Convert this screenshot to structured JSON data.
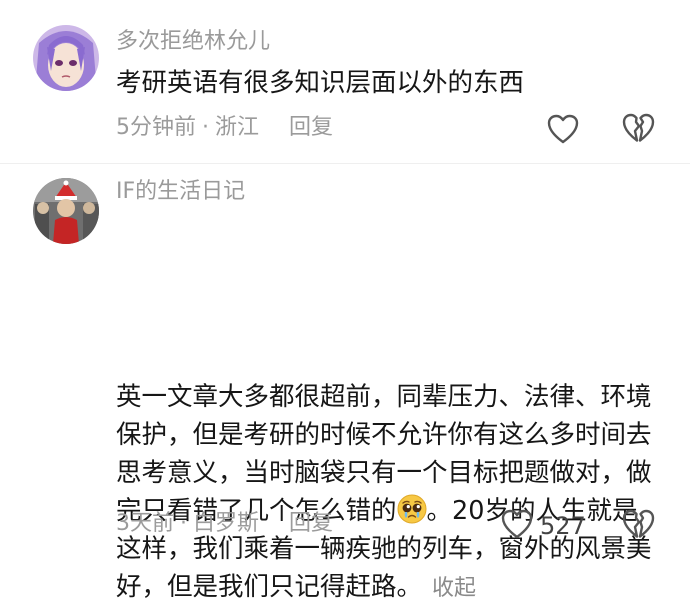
{
  "comments": [
    {
      "username": "多次拒绝林允儿",
      "text": "考研英语有很多知识层面以外的东西",
      "time": "5分钟前",
      "separator": "·",
      "location": "浙江",
      "reply_label": "回复"
    },
    {
      "username": "IF的生活日记",
      "text_part1": "英一文章大多都很超前，同辈压力、法律、环境保护，但是考研的时候不允许你有这么多时间去思考意义，当时脑袋只有一个目标把题做对，做完只看错了几个怎么错的",
      "text_part2": "。20岁的人生就是这样，我们乘着一辆疾驰的列车，窗外的风景美好，但是我们只记得赶路。",
      "emoji": "pleading-face",
      "collapse_label": "收起",
      "time": "3天前",
      "separator": "·",
      "location": "白罗斯",
      "reply_label": "回复",
      "like_count": "527"
    }
  ],
  "icons": {
    "like": "heart-outline-icon",
    "dislike": "broken-heart-outline-icon"
  }
}
